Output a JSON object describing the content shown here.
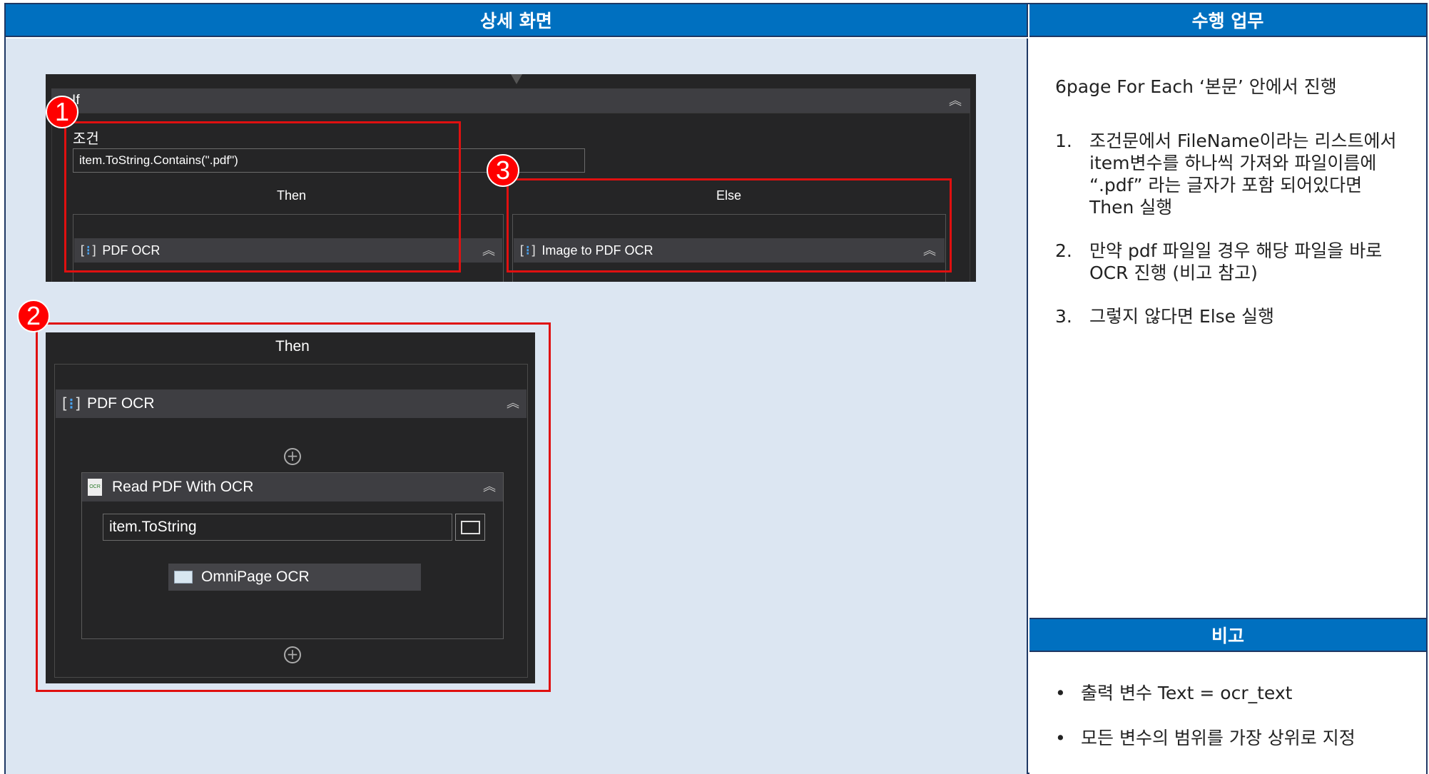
{
  "headers": {
    "detail_screen": "상세 화면",
    "tasks": "수행 업무",
    "notes": "비고"
  },
  "designer_top": {
    "if_label": "If",
    "condition_label": "조건",
    "condition_value": "item.ToString.Contains(\".pdf\")",
    "then_label": "Then",
    "else_label": "Else",
    "then_sequence": "PDF OCR",
    "else_sequence": "Image to PDF OCR"
  },
  "designer_then": {
    "then_label": "Then",
    "sequence": "PDF OCR",
    "activity": "Read PDF With OCR",
    "file_input": "item.ToString",
    "ocr_engine": "OmniPage OCR"
  },
  "badges": [
    "1",
    "2",
    "3"
  ],
  "tasks": {
    "intro": "6page For Each ‘본문’ 안에서 진행",
    "steps": [
      {
        "num": "1.",
        "text": "조건문에서 FileName이라는 리스트에서 item변수를 하나씩 가져와 파일이름에 “.pdf” 라는 글자가 포함 되어있다면 Then 실행"
      },
      {
        "num": "2.",
        "text": "만약 pdf 파일일 경우 해당 파일을 바로 OCR 진행 (비고 참고)"
      },
      {
        "num": "3.",
        "text": "그렇지 않다면 Else 실행"
      }
    ]
  },
  "notes": [
    {
      "bullet": "•",
      "text": "출력 변수 Text = ocr_text"
    },
    {
      "bullet": "•",
      "text": "모든 변수의 범위를 가장 상위로 지정"
    }
  ],
  "icons": {
    "collapse": "double-chevron-up-icon",
    "sequence": "sequence-icon",
    "folder": "folder-icon",
    "add": "plus-circle-icon",
    "ocr": "ocr-icon"
  },
  "colors": {
    "header_blue": "#0070c0",
    "left_bg": "#dce6f2",
    "designer_dark": "#252526",
    "highlight_red": "#e01010"
  }
}
